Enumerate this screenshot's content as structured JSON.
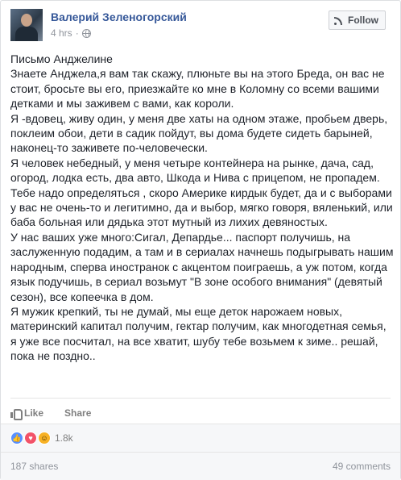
{
  "author": {
    "name": "Валерий Зеленогорский",
    "time": "4 hrs",
    "separator": "·"
  },
  "follow_label": "Follow",
  "post_paragraphs": [
    "Письмо Анджелине",
    "Знаете Анджела,я вам так скажу, плюньте вы на этого Бреда, он вас не стоит, бросьте вы его, приезжайте ко мне в Коломну со всеми вашими детками и мы заживем с вами, как короли.",
    "Я -вдовец, живу один, у меня две хаты на одном этаже, пробьем дверь, поклеим обои, дети в садик пойдут, вы дома будете сидеть барыней, наконец-то заживете по-человечески.",
    "Я человек небедный, у меня четыре контейнера на рынке, дача, сад, огород, лодка есть, два авто, Шкода и Нива с прицепом, не пропадем. Тебе надо определяться , скоро Америке кирдык будет, да и с выборами у вас не очень-то и легитимно, да и выбор, мягко говоря, вяленький, или баба больная или дядька этот мутный из лихих девяностых.",
    "У нас ваших уже много:Сигал, Депардье... паспорт получишь, на заслуженную подадим, а там и в сериалах начнешь подыгрывать нашим народным, сперва иностранок с акцентом поиграешь, а уж потом, когда язык подучишь, в сериал возьмут \"В зоне особого внимания\" (девятый сезон), все копеечка в дом.",
    "Я мужик крепкий, ты не думай, мы еще деток нарожаем новых, материнский капитал получим, гектар получим, как многодетная семья, я уже все посчитал, на все хватит, шубу тебе возьмем к зиме.. решай, пока не поздно.."
  ],
  "actions": {
    "like": "Like",
    "share": "Share"
  },
  "reactions": {
    "count": "1.8k",
    "icons": [
      "like-icon",
      "love-icon",
      "haha-icon"
    ]
  },
  "footer": {
    "shares": "187 shares",
    "comments": "49 comments"
  },
  "colors": {
    "author_link": "#365899",
    "like_blue": "#5890ff",
    "love_red": "#f25268",
    "haha_yellow": "#f7b125"
  }
}
